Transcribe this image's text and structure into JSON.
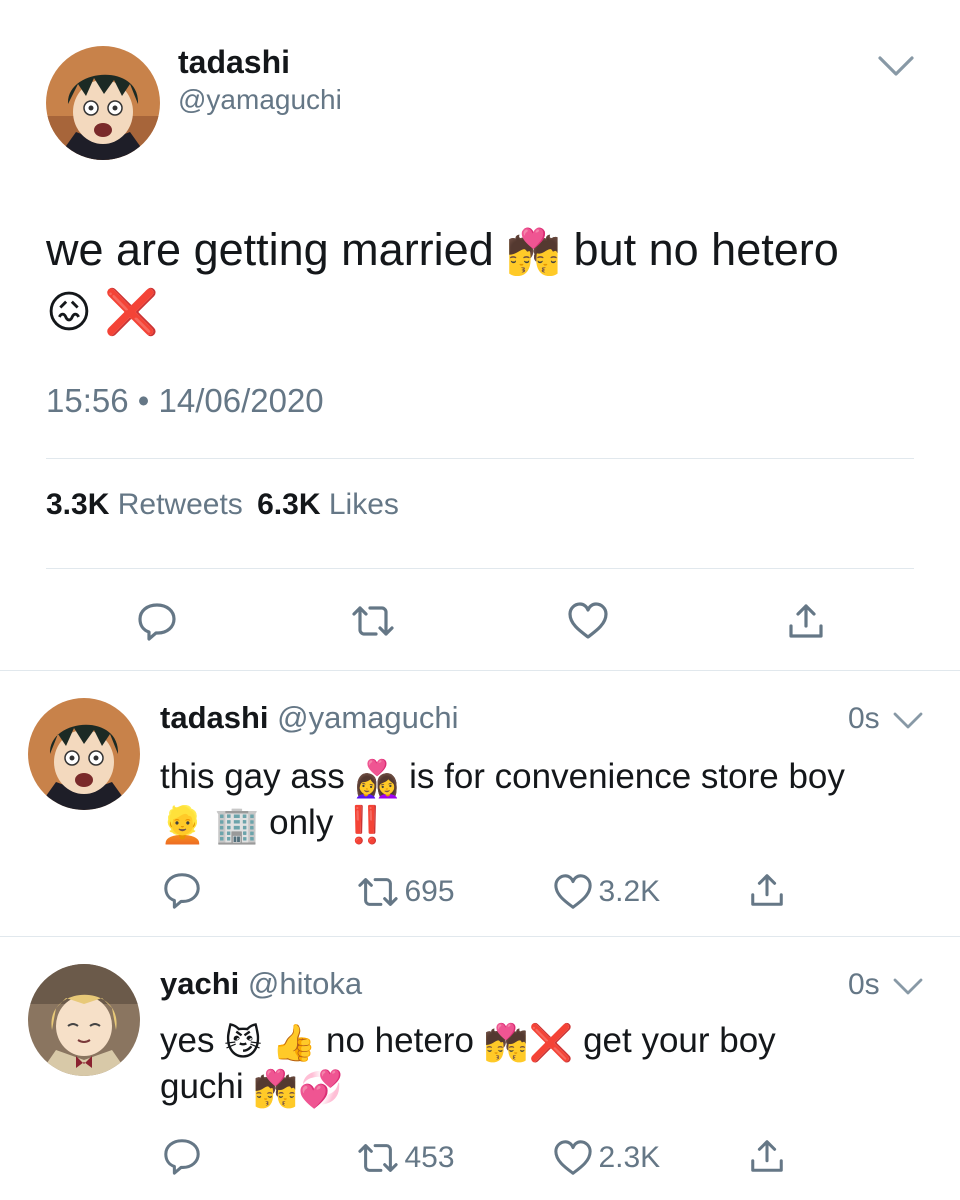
{
  "main_tweet": {
    "display_name": "tadashi",
    "handle": "@yamaguchi",
    "text_part1": "we are getting married",
    "emoji_couple": "💏",
    "text_part2": "but no hetero",
    "emoji_confounded": "😖",
    "emoji_cross": "❌",
    "time": "15:56",
    "separator": "•",
    "date": "14/06/2020",
    "retweets_count": "3.3K",
    "retweets_label": "Retweets",
    "likes_count": "6.3K",
    "likes_label": "Likes"
  },
  "replies": [
    {
      "display_name": "tadashi",
      "handle": "@yamaguchi",
      "age": "0s",
      "text_a": "this gay ass",
      "emoji_1": "👩‍❤️‍👩",
      "text_b": "is for convenience store boy",
      "emoji_2": "👱",
      "emoji_3": "🏢",
      "text_c": "only",
      "emoji_4": "‼️",
      "retweets": "695",
      "likes": "3.2K"
    },
    {
      "display_name": "yachi",
      "handle": "@hitoka",
      "age": "0s",
      "text_a": "yes",
      "emoji_1": "😼",
      "emoji_2": "👍",
      "text_b": "no hetero",
      "emoji_3": "💏",
      "emoji_4": "❌",
      "text_c": "get your boy",
      "text_d": "guchi",
      "emoji_5": "💏",
      "emoji_6": "💞",
      "retweets": "453",
      "likes": "2.3K"
    }
  ],
  "icons": {
    "chevron": "chevron-down-icon",
    "reply": "reply-icon",
    "retweet": "retweet-icon",
    "like": "heart-icon",
    "share": "share-icon"
  },
  "colors": {
    "text": "#14171a",
    "secondary": "#657786",
    "divider": "#e1e8ed",
    "cross": "#e0213b",
    "bangbang": "#e0213b"
  }
}
